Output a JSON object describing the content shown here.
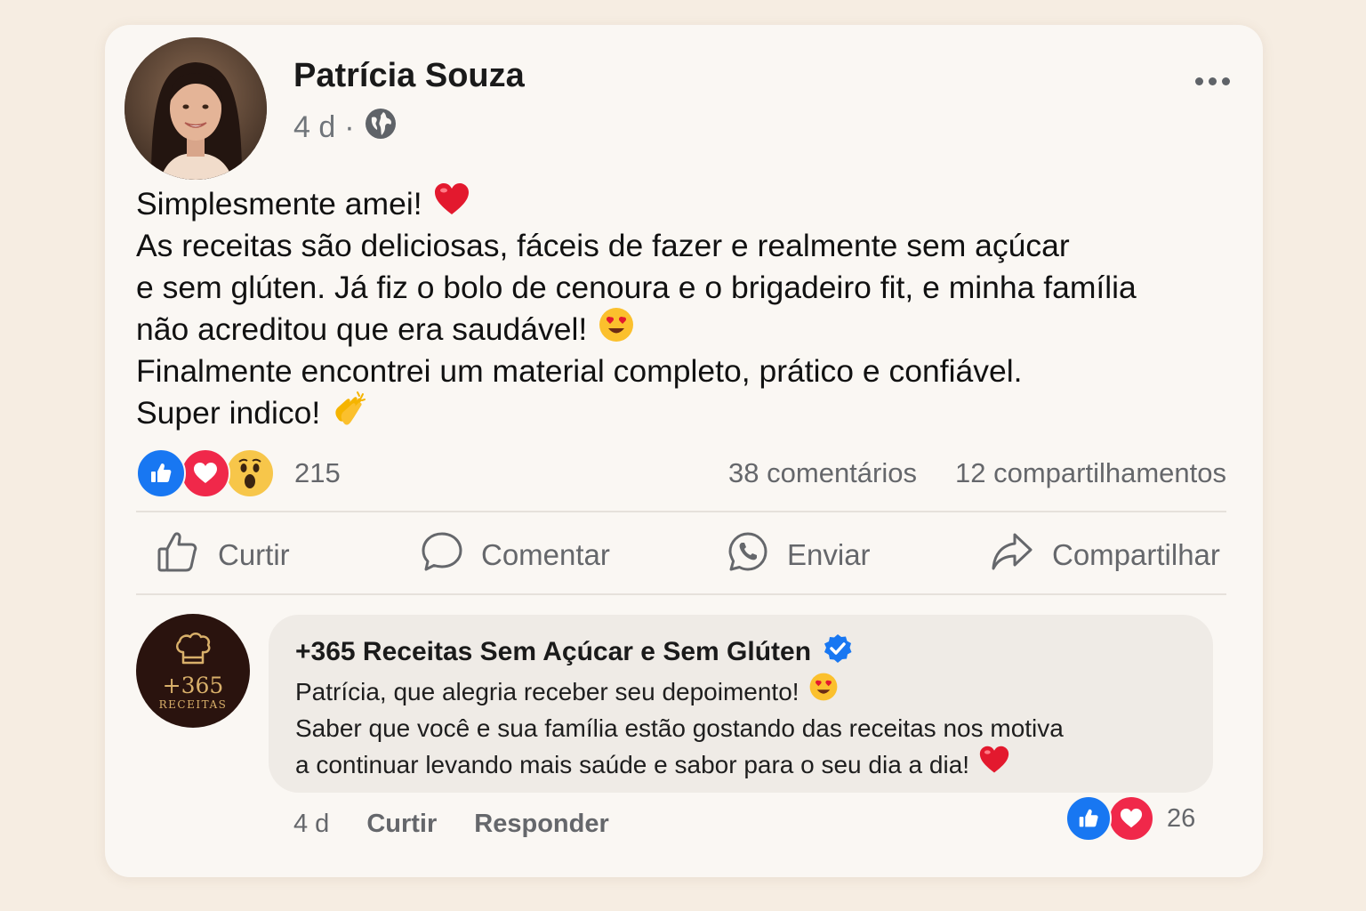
{
  "post": {
    "author": "Patrícia Souza",
    "time": "4 d",
    "separator": "·",
    "audience_icon": "globe-icon",
    "lines": [
      "Simplesmente amei!",
      "As receitas são deliciosas, fáceis de fazer e realmente sem açúcar",
      "e sem glúten. Já fiz o bolo de cenoura e o brigadeiro fit, e minha família",
      "não acreditou que era saudável!",
      "Finalmente encontrei um material completo, prático e confiável.",
      "Super indico!"
    ],
    "emojis": [
      "red-heart",
      "heart-eyes",
      "clapping-hands"
    ],
    "reactions": {
      "icons": [
        "like",
        "love",
        "wow"
      ],
      "count": "215"
    },
    "comments_count": "38 comentários",
    "shares_count": "12 compartilhamentos"
  },
  "actions": {
    "like": "Curtir",
    "comment": "Comentar",
    "send": "Enviar",
    "share": "Compartilhar"
  },
  "comment": {
    "author": "+365 Receitas Sem Açúcar e Sem Glúten",
    "verified": true,
    "avatar_text": "+365",
    "avatar_subtext": "RECEITAS",
    "lines": [
      "Patrícia, que alegria receber seu depoimento!",
      "Saber que você e sua família estão gostando das receitas nos motiva",
      "a continuar levando mais saúde e sabor para o seu dia a dia!"
    ],
    "time": "4 d",
    "like_label": "Curtir",
    "reply_label": "Responder",
    "reactions": {
      "icons": [
        "like",
        "love"
      ],
      "count": "26"
    }
  },
  "colors": {
    "background": "#f6ede2",
    "card": "#faf7f3",
    "like_blue": "#1877f2",
    "love_red": "#f0284a",
    "wow_yellow": "#f7c64a",
    "muted_text": "#65676b",
    "brand_dark": "#2a130e",
    "brand_gold": "#d9b06a"
  }
}
